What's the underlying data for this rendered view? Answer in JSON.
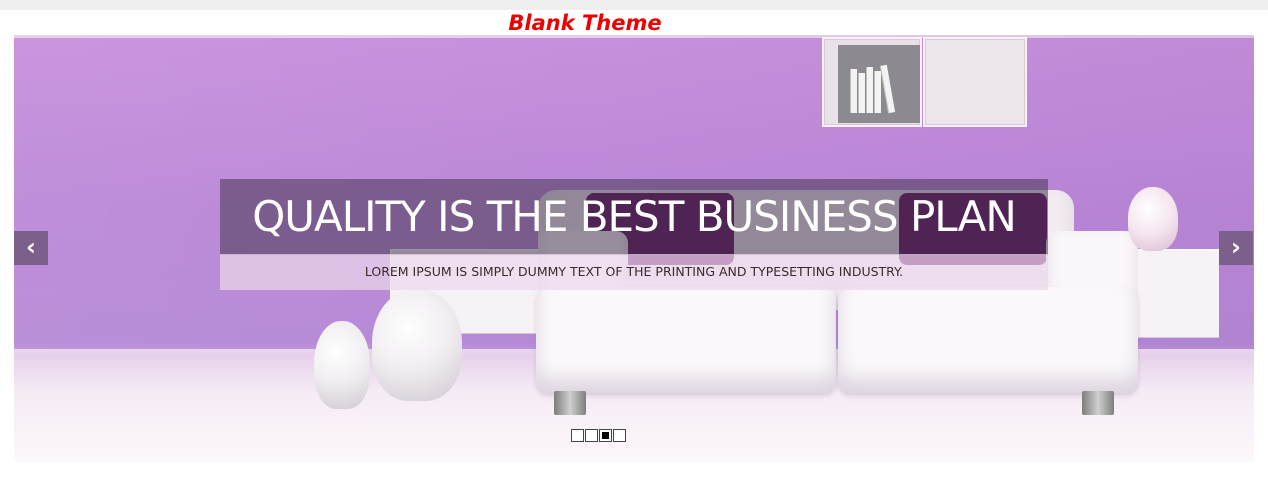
{
  "site": {
    "title": "Blank Theme",
    "title_color": "#ee0000"
  },
  "slider": {
    "caption_title": "QUALITY IS THE BEST BUSINESS PLAN",
    "caption_subtitle": "LOREM IPSUM IS SIMPLY DUMMY TEXT OF THE PRINTING AND TYPESETTING INDUSTRY.",
    "prev_icon": "chevron-left-icon",
    "next_icon": "chevron-right-icon",
    "prev_glyph": "‹",
    "next_glyph": "›",
    "slide_count": 4,
    "active_slide": 3,
    "accent_color": "#b98ad6"
  }
}
